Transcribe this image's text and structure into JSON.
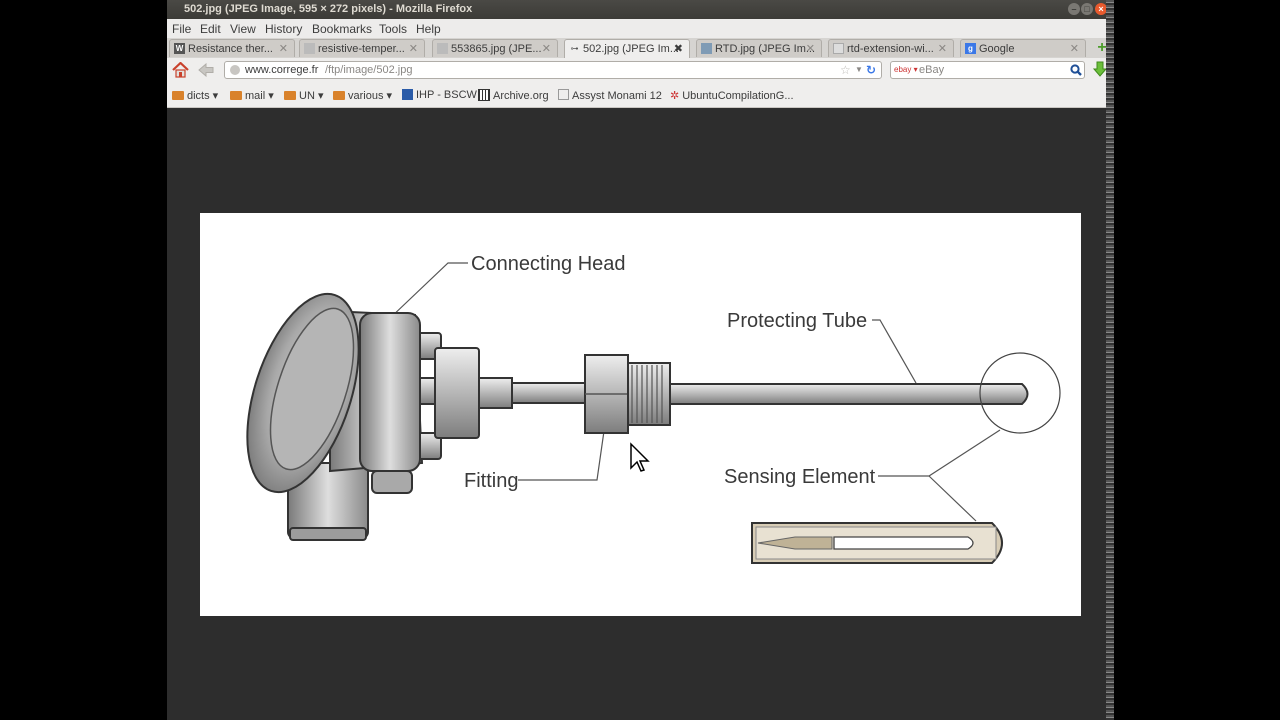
{
  "window": {
    "title": "502.jpg (JPEG Image, 595 × 272 pixels) - Mozilla Firefox"
  },
  "menu": [
    "File",
    "Edit",
    "View",
    "History",
    "Bookmarks",
    "Tools",
    "Help"
  ],
  "tabs": [
    {
      "label": "Resistance ther...",
      "icon": "wikipedia-icon"
    },
    {
      "label": "resistive-temper...",
      "icon": "image-icon"
    },
    {
      "label": "553865.jpg (JPE...",
      "icon": "image-icon"
    },
    {
      "label": "502.jpg (JPEG Im...",
      "icon": "image-icon",
      "active": true
    },
    {
      "label": "RTD.jpg (JPEG Im...",
      "icon": "image-icon"
    },
    {
      "label": "rtd-extension-wi...",
      "icon": "image-icon"
    },
    {
      "label": "Google",
      "icon": "google-icon"
    }
  ],
  "urlbar": {
    "host": "www.correge.fr",
    "path": "/ftp/image/502.jpg"
  },
  "search": {
    "engine": "eBay",
    "placeholder": "eBay"
  },
  "bookmarks": [
    {
      "label": "dicts",
      "folder": true
    },
    {
      "label": "mail",
      "folder": true
    },
    {
      "label": "UN",
      "folder": true
    },
    {
      "label": "various",
      "folder": true
    },
    {
      "label": "IHP - BSCW",
      "folder": false
    },
    {
      "label": "Archive.org",
      "folder": false
    },
    {
      "label": "Assyst Monami 12",
      "folder": false
    },
    {
      "label": "UbuntuCompilationG...",
      "folder": false
    }
  ],
  "diagram": {
    "labels": {
      "connecting_head": "Connecting Head",
      "protecting_tube": "Protecting Tube",
      "fitting": "Fitting",
      "sensing_element": "Sensing Element"
    }
  },
  "colors": {
    "close_button": "#e85a2e",
    "folder": "#d9822b",
    "page_bg": "#2d2d2d"
  }
}
